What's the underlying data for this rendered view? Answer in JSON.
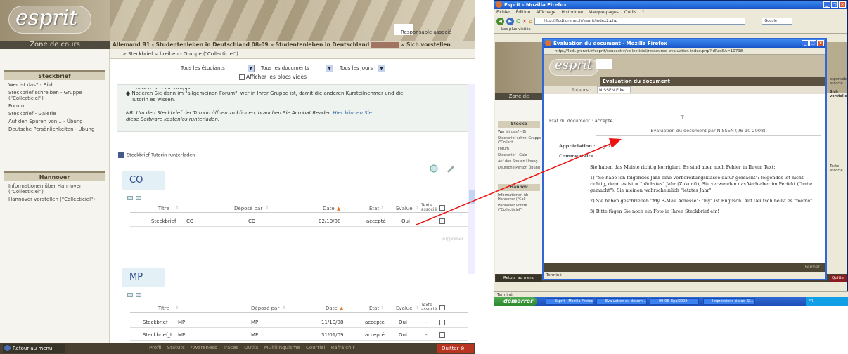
{
  "left": {
    "logo": "esprit",
    "zone": "Zone de cours",
    "breadcrumb_a": "Allemand B1 - Studentenleben in Deutschland 08-09 » Studentenleben in Deutschland",
    "breadcrumb_b": "» Sich vorstellen",
    "responsable": "Responsable associé",
    "subbar": "Steckbrief schreiben - Gruppe (\"Collecticiel\")",
    "filters": {
      "students": "Tous les étudiants",
      "docs": "Tous les documents",
      "days": "Tous les jours"
    },
    "show_blocks": "Afficher les blocs vides",
    "sidebar": {
      "section1": "Steckbrief",
      "items1": [
        "Wer ist das? - Bild",
        "Steckbrief schreiben - Gruppe (\"Collecticiel\")",
        "Forum",
        "Steckbrief - Galerie",
        "Auf den Spuren von... - Übung",
        "Deutsche Persönlichkeiten - Übung"
      ],
      "section2": "Hannover",
      "items2": [
        "Informationen über Hannover (\"Collecticiel\")",
        "Hannover vorstellen (\"Collecticiel\")"
      ]
    },
    "info": {
      "line1": "Bilden Sie eine Gruppe.",
      "line2": "Notieren Sie dann im \"allgemeinen Forum\", wer in Ihrer Gruppe ist, damit die anderen Kursteilnehmer und die",
      "line3": "Tutorin es wissen.",
      "nb": "NB: Um den Steckbrief der Tutorin öffnen zu können, brauchen Sie Acrobat Reader.",
      "nb_link": "Hier können Sie",
      "nb_tail": "diese Software kostenlos runterladen."
    },
    "download": "Steckbrief Tutorin runterladen",
    "columns": {
      "titre": "Titre",
      "depose": "Déposé par",
      "date": "Date",
      "etat": "Etat",
      "evalue": "Evalué",
      "texte": "Texte",
      "texte2": "associé"
    },
    "group_co": {
      "name": "CO",
      "rows": [
        {
          "titre": "Steckbrief",
          "titre_name": "CO",
          "depose": "CO",
          "date": "02/10/08",
          "etat": "accepté",
          "evalue": "Oui",
          "texte": "-"
        }
      ],
      "delete": "Supprimer"
    },
    "group_mp": {
      "name": "MP",
      "rows": [
        {
          "titre": "Steckbrief",
          "titre_name": "MP",
          "depose": "MP",
          "date": "11/10/08",
          "etat": "accepté",
          "evalue": "Oui",
          "texte": "-"
        },
        {
          "titre": "Steckbrief_I",
          "titre_name": "MP",
          "depose": "MP",
          "date": "31/01/09",
          "etat": "accepté",
          "evalue": "Oui",
          "texte": "-"
        }
      ]
    },
    "bottom": {
      "back": "Retour au menu",
      "menu": [
        "Profil",
        "Statuts",
        "Awareness",
        "Traces",
        "Outils",
        "Multilinguisme",
        "Courriel",
        "Rafraîchir"
      ],
      "quit": "Quitter"
    }
  },
  "right": {
    "title": "Esprit - Mozilla Firefox",
    "menubar": [
      "Fichier",
      "Édition",
      "Affichage",
      "Historique",
      "Marque-pages",
      "Outils",
      "?"
    ],
    "url": "http://flodi.grenet.fr/esprit/index2.php",
    "search": "Google",
    "bookmark": "Les plus visités",
    "status": "Terminé",
    "taskbar": {
      "start": "démarrer",
      "tasks": [
        "Esprit - Mozilla Firefox",
        "Evaluation du docum...",
        "09-06_Epal2009",
        "Impressions_écran_Sl..."
      ],
      "tray": "FR"
    },
    "behind": {
      "zone": "Zone de",
      "section": "Steckb",
      "items": [
        "Wer ist das? - Bi",
        "Steckbrief schrei Gruppe (\"Collect",
        "Forum",
        "Steckbrief - Gale",
        "Auf den Spuren Übung",
        "Deutsche Persön Übung"
      ],
      "section2": "Hannov",
      "items2": [
        "Informationen üb Hannover (\"Coll",
        "Hannover vorste (\"Collecticiel\")"
      ],
      "crumb1": "esponsable associé",
      "crumb2": "Sich vorstellen",
      "col": "Texte associé",
      "back": "Retour au menu",
      "quit": "Quitter"
    },
    "popup": {
      "title": "Evaluation du document - Mozilla Firefox",
      "url": "http://flodi.grenet.fr/esprit/sousactiv/collecticiel/ressource_evaluation-index.php?idResSA=10798",
      "heading": "Evaluation du document",
      "tuteurs_label": "Tuteurs :",
      "tuteurs_value": "NISSEN Elke",
      "marker": "T",
      "etat_label": "État du document :",
      "etat_value": "accepté",
      "eval_par": "Evaluation du document par NISSEN (06-10-2008)",
      "appreciation_label": "Appréciation :",
      "appreciation_value": "gut",
      "commentaire_label": "Commentaire :",
      "intro": "Sie haben das Meiste richtig korrigiert. Es sind aber noch Fehler in Ihrem Text:",
      "p1": "1) \"So habe ich folgendes Jahr eine Vorbereitungsklasse dafür gemacht\": folgendes ist nicht richtig, denn es ist = \"nächstes\" Jahr (Zukunft); Sie verwenden das Verb aber im Perfekt (\"habe gemacht\"). Sie meinen wahrscheinlich \"letztes Jahr\".",
      "p2": "2) Sie haben geschrieben \"My E-Mail Adresse\": \"my\" ist Englisch. Auf Deutsch heißt es \"meine\".",
      "p3": "3) Bitte fügen Sie noch ein Foto in Ihren Steckbrief ein!",
      "close": "Fermer",
      "status": "Terminé"
    }
  }
}
